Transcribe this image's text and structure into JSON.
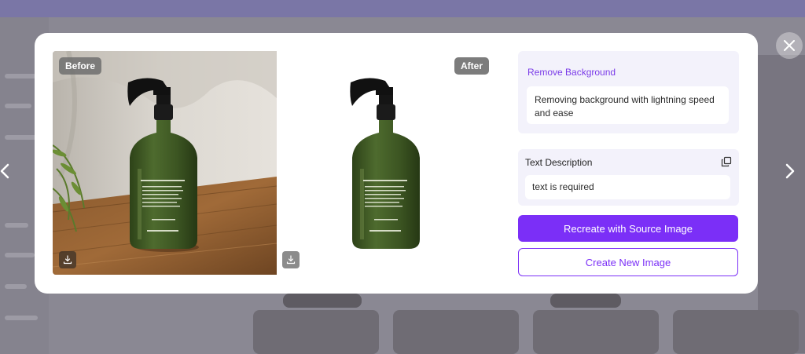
{
  "modal": {
    "before_label": "Before",
    "after_label": "After",
    "feature": {
      "title": "Remove Background",
      "description": "Removing background with lightning speed and ease"
    },
    "text_description": {
      "label": "Text Description",
      "value": "text is required"
    },
    "buttons": {
      "recreate": "Recreate with Source Image",
      "create_new": "Create New Image"
    }
  },
  "icons": {
    "close": "close-icon",
    "prev": "chevron-left-icon",
    "next": "chevron-right-icon",
    "download": "download-icon",
    "copy": "copy-icon"
  },
  "colors": {
    "accent": "#7b2ff7",
    "feature_title": "#7a3be8",
    "panel_bg": "#f3f2fb",
    "bottle_green": "#3f5a26"
  }
}
